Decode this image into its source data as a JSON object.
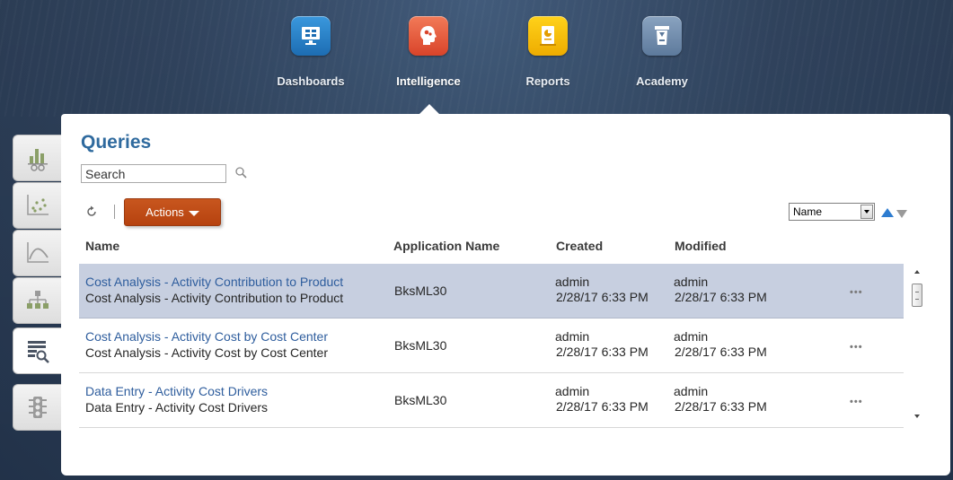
{
  "nav": {
    "items": [
      {
        "label": "Dashboards",
        "icon": "dashboards-icon",
        "color": "#2b7fc4"
      },
      {
        "label": "Intelligence",
        "icon": "intelligence-icon",
        "color": "#e8583a",
        "active": true
      },
      {
        "label": "Reports",
        "icon": "reports-icon",
        "color": "#f2b800"
      },
      {
        "label": "Academy",
        "icon": "academy-icon",
        "color": "#6a86a8"
      }
    ]
  },
  "side_tabs": [
    {
      "icon": "bar-chart-icon"
    },
    {
      "icon": "scatter-plot-icon"
    },
    {
      "icon": "curve-chart-icon"
    },
    {
      "icon": "hierarchy-icon"
    },
    {
      "icon": "query-list-icon",
      "active": true
    },
    {
      "icon": "traffic-light-icon"
    }
  ],
  "page": {
    "title": "Queries",
    "search_value": "Search",
    "actions_label": "Actions",
    "sort_by": "Name"
  },
  "columns": {
    "name": "Name",
    "application": "Application Name",
    "created": "Created",
    "modified": "Modified"
  },
  "rows": [
    {
      "name": "Cost Analysis - Activity Contribution to Product",
      "description": "Cost Analysis - Activity Contribution to Product",
      "application": "BksML30",
      "created_by": "admin",
      "created_at": "2/28/17 6:33 PM",
      "modified_by": "admin",
      "modified_at": "2/28/17 6:33 PM",
      "more": "•••",
      "selected": true
    },
    {
      "name": "Cost Analysis - Activity Cost by Cost Center",
      "description": "Cost Analysis - Activity Cost by Cost Center",
      "application": "BksML30",
      "created_by": "admin",
      "created_at": "2/28/17 6:33 PM",
      "modified_by": "admin",
      "modified_at": "2/28/17 6:33 PM",
      "more": "•••"
    },
    {
      "name": "Data Entry - Activity Cost Drivers",
      "description": "Data Entry - Activity Cost Drivers",
      "application": "BksML30",
      "created_by": "admin",
      "created_at": "2/28/17 6:33 PM",
      "modified_by": "admin",
      "modified_at": "2/28/17 6:33 PM",
      "more": "•••"
    }
  ]
}
